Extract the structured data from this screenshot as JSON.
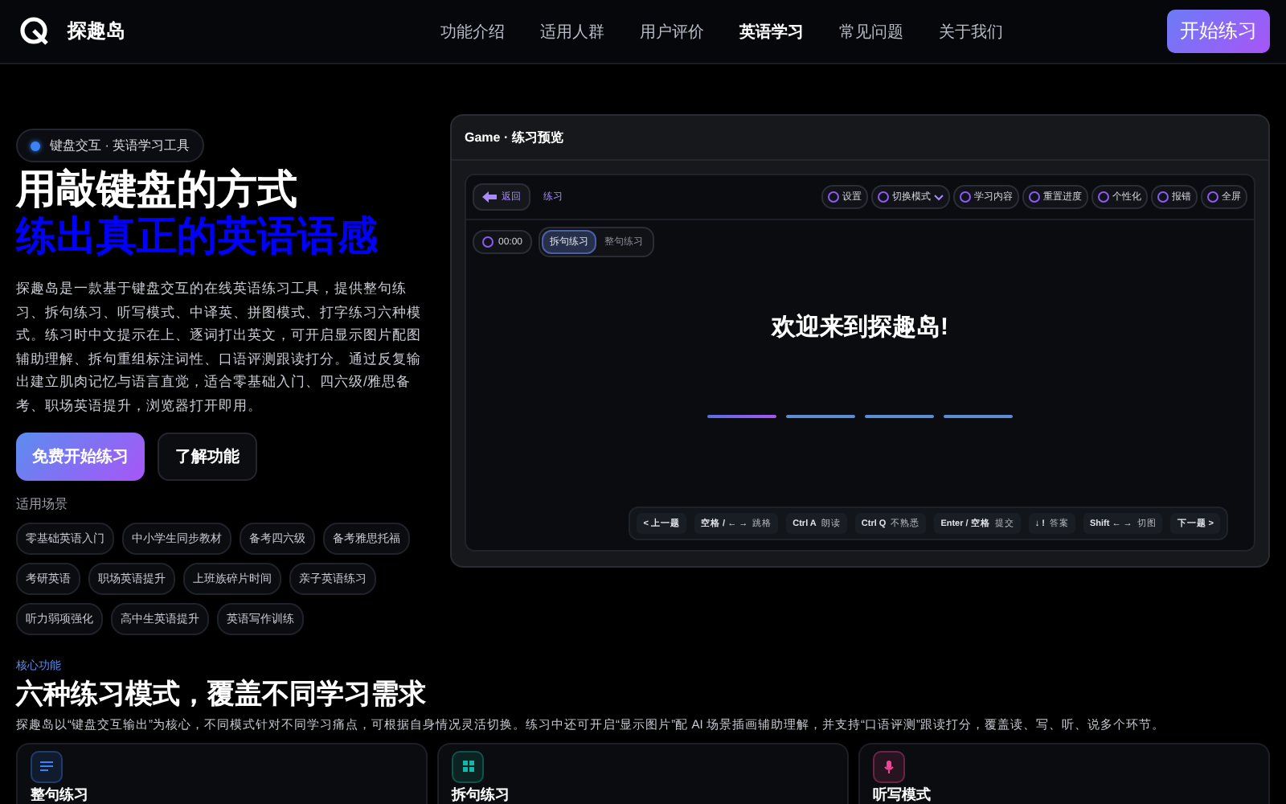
{
  "header": {
    "brand": "探趣岛",
    "nav": [
      {
        "label": "功能介绍",
        "selected": false
      },
      {
        "label": "适用人群",
        "selected": false
      },
      {
        "label": "用户评价",
        "selected": false
      },
      {
        "label": "英语学习",
        "selected": true
      },
      {
        "label": "常见问题",
        "selected": false
      },
      {
        "label": "关于我们",
        "selected": false
      }
    ],
    "cta": "开始练习"
  },
  "hero": {
    "pill": "键盘交互 · 英语学习工具",
    "title_line_1": "用**敲键盘**的方式",
    "title_line_2": "练出真正的英语语感",
    "description": "探趣岛是一款基于键盘交互的在线英语练习工具，提供整句练习、拆句练习、听写模式、中译英、拼图模式、打字练习六种模式。练习时中文提示在上、逐词打出英文，可开启显示图片配图辅助理解、拆句重组标注词性、口语评测跟读打分。通过反复输出建立肌肉记忆与语言直觉，适合零基础入门、四六级/雅思备考、职场英语提升，浏览器打开即用。",
    "primary_button": "免费开始练习",
    "secondary_button": "了解功能",
    "scenes_label": "适用场景",
    "scenes": [
      "零基础英语入门",
      "中小学生同步教材",
      "备考四六级",
      "备考雅思托福",
      "考研英语",
      "职场英语提升",
      "上班族碎片时间",
      "亲子英语练习",
      "听力弱项强化",
      "高中生英语提升",
      "英语写作训练"
    ]
  },
  "preview": {
    "title": "Game · 练习预览",
    "back": "返回",
    "crumb": "练习",
    "tools": [
      {
        "label": "设置",
        "kind": "plain"
      },
      {
        "label": "切换模式",
        "kind": "dropdown"
      },
      {
        "label": "学习内容",
        "kind": "plain"
      },
      {
        "label": "重置进度",
        "kind": "plain"
      },
      {
        "label": "个性化",
        "kind": "plain"
      },
      {
        "label": "报错",
        "kind": "plain"
      },
      {
        "label": "全屏",
        "kind": "plain"
      }
    ],
    "timer": "00:00",
    "modes": [
      {
        "label": "拆句练习",
        "selected": true
      },
      {
        "label": "整句练习",
        "selected": false
      }
    ],
    "welcome": "欢迎来到探趣岛!",
    "slots": [
      {
        "selected": true
      },
      {
        "selected": false
      },
      {
        "selected": false
      },
      {
        "selected": false
      }
    ],
    "shortcuts": [
      {
        "key": "< 上一题"
      },
      {
        "key": "空格 / ← →",
        "action": "跳格"
      },
      {
        "key": "Ctrl A",
        "action": "朗读"
      },
      {
        "key": "Ctrl Q",
        "action": "不熟悉"
      },
      {
        "key": "Enter / 空格",
        "action": "提交"
      },
      {
        "key": "↓ !",
        "action": "答案"
      },
      {
        "key": "Shift ← →",
        "action": "切图"
      },
      {
        "key": "下一题 >"
      }
    ]
  },
  "features": {
    "eyebrow": "核心功能",
    "title": "六种练习模式，覆盖不同学习需求",
    "description": "探趣岛以“键盘交互输出”为核心，不同模式针对不同学习痛点，可根据自身情况灵活切换。练习中还可开启“显示图片”配 AI 场景插画辅助理解，并支持“口语评测”跟读打分，覆盖读、写、听、说多个环节。",
    "cards": [
      {
        "title": "整句练习",
        "kind": "lines",
        "color": "#3b82f6"
      },
      {
        "title": "拆句练习",
        "kind": "grid",
        "color": "#14b8a6"
      },
      {
        "title": "听写模式",
        "kind": "mic",
        "color": "#ec4899"
      }
    ]
  }
}
